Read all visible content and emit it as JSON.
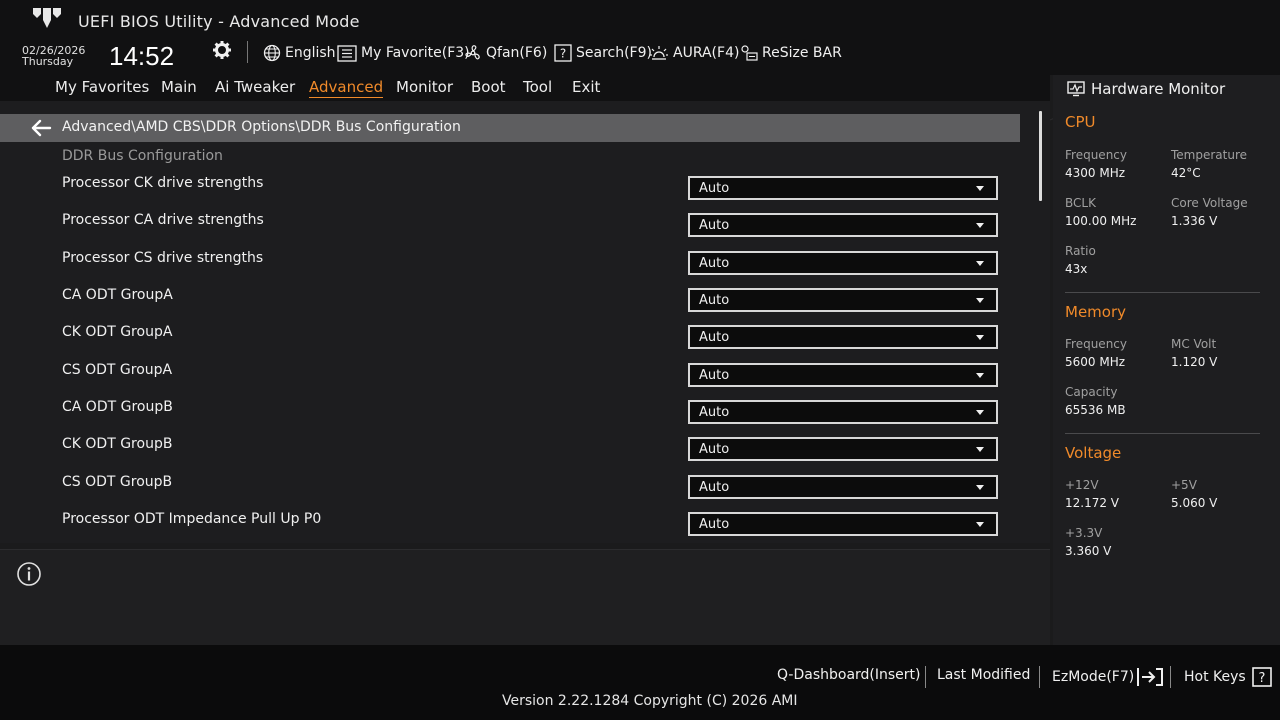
{
  "header": {
    "title": "UEFI BIOS Utility - Advanced Mode",
    "date": "02/26/2026",
    "day": "Thursday",
    "time": "14:52",
    "items": [
      {
        "label": "English",
        "icon": "globe-icon"
      },
      {
        "label": "My Favorite(F3)",
        "icon": "favorite-list-icon"
      },
      {
        "label": "Qfan(F6)",
        "icon": "fan-icon"
      },
      {
        "label": "Search(F9)",
        "icon": "search-help-icon"
      },
      {
        "label": "AURA(F4)",
        "icon": "aura-light-icon"
      },
      {
        "label": "ReSize BAR",
        "icon": "resize-bar-icon"
      }
    ]
  },
  "nav": {
    "tabs": [
      {
        "label": "My Favorites"
      },
      {
        "label": "Main"
      },
      {
        "label": "Ai Tweaker"
      },
      {
        "label": "Advanced",
        "active": true
      },
      {
        "label": "Monitor"
      },
      {
        "label": "Boot"
      },
      {
        "label": "Tool"
      },
      {
        "label": "Exit"
      }
    ]
  },
  "main": {
    "breadcrumb": "Advanced\\AMD CBS\\DDR Options\\DDR Bus Configuration",
    "section_title": "DDR Bus Configuration",
    "settings": [
      {
        "label": "Processor CK drive strengths",
        "value": "Auto"
      },
      {
        "label": "Processor CA drive strengths",
        "value": "Auto"
      },
      {
        "label": "Processor CS drive strengths",
        "value": "Auto"
      },
      {
        "label": "CA ODT GroupA",
        "value": "Auto"
      },
      {
        "label": "CK ODT GroupA",
        "value": "Auto"
      },
      {
        "label": "CS ODT GroupA",
        "value": "Auto"
      },
      {
        "label": "CA ODT GroupB",
        "value": "Auto"
      },
      {
        "label": "CK ODT GroupB",
        "value": "Auto"
      },
      {
        "label": "CS ODT GroupB",
        "value": "Auto"
      },
      {
        "label": "Processor ODT Impedance Pull Up P0",
        "value": "Auto"
      }
    ]
  },
  "hardware_monitor": {
    "title": "Hardware Monitor",
    "cpu": {
      "title": "CPU",
      "frequency_label": "Frequency",
      "frequency": "4300 MHz",
      "temperature_label": "Temperature",
      "temperature": "42°C",
      "bclk_label": "BCLK",
      "bclk": "100.00 MHz",
      "core_voltage_label": "Core Voltage",
      "core_voltage": "1.336 V",
      "ratio_label": "Ratio",
      "ratio": "43x"
    },
    "memory": {
      "title": "Memory",
      "frequency_label": "Frequency",
      "frequency": "5600 MHz",
      "mc_volt_label": "MC Volt",
      "mc_volt": "1.120 V",
      "capacity_label": "Capacity",
      "capacity": "65536 MB"
    },
    "voltage": {
      "title": "Voltage",
      "v12_label": "+12V",
      "v12": "12.172 V",
      "v5_label": "+5V",
      "v5": "5.060 V",
      "v33_label": "+3.3V",
      "v33": "3.360 V"
    }
  },
  "footer": {
    "q_dashboard": "Q-Dashboard(Insert)",
    "last_modified": "Last Modified",
    "ezmode": "EzMode(F7)",
    "hot_keys": "Hot Keys",
    "version": "Version 2.22.1284 Copyright (C) 2026 AMI"
  },
  "colors": {
    "accent": "#f08a2a",
    "background": "#1b1b1c",
    "header_bg": "#111112",
    "breadcrumb_bg": "#5e5e60"
  }
}
